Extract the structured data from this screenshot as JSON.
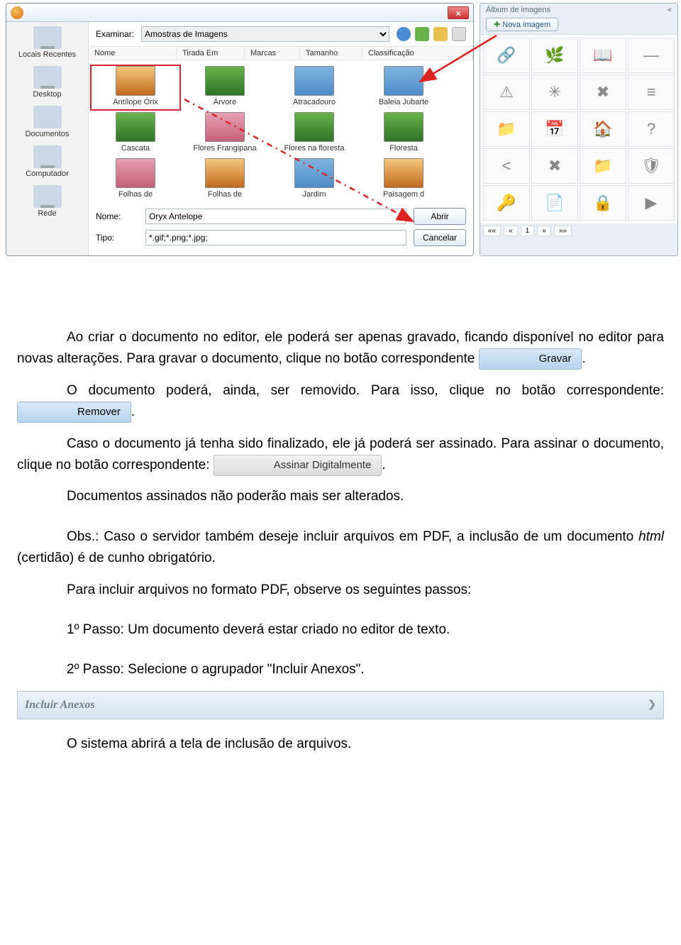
{
  "dialog": {
    "examine_label": "Examinar:",
    "folder": "Amostras de Imagens",
    "columns": [
      "Nome",
      "Tirada Em",
      "Marcas",
      "Tamanho",
      "Classificação"
    ],
    "sidebar": [
      {
        "label": "Locais Recentes"
      },
      {
        "label": "Desktop"
      },
      {
        "label": "Documentos"
      },
      {
        "label": "Computador"
      },
      {
        "label": "Rede"
      }
    ],
    "files": [
      {
        "name": "Antílope Órix",
        "cls": "orange",
        "selected": true
      },
      {
        "name": "Árvore",
        "cls": "green"
      },
      {
        "name": "Atracadouro",
        "cls": ""
      },
      {
        "name": "Baleia Jubarte",
        "cls": ""
      },
      {
        "name": "Cascata",
        "cls": "green"
      },
      {
        "name": "Flores Frangipana",
        "cls": "pink"
      },
      {
        "name": "Flores na floresta",
        "cls": "green"
      },
      {
        "name": "Floresta",
        "cls": "green"
      },
      {
        "name": "Folhas de",
        "cls": "pink"
      },
      {
        "name": "Folhas de",
        "cls": "orange"
      },
      {
        "name": "Jardim",
        "cls": ""
      },
      {
        "name": "Paisagem d",
        "cls": "orange"
      }
    ],
    "name_label": "Nome:",
    "name_value": "Oryx Antelope",
    "type_label": "Tipo:",
    "type_value": "*.gif;*.png;*.jpg;",
    "open_btn": "Abrir",
    "cancel_btn": "Cancelar"
  },
  "album": {
    "title": "Álbum de imagens",
    "new_btn": "Nova imagem",
    "icons": [
      "🔗",
      "🌿",
      "📖",
      "—",
      "⚠",
      "✳",
      "✖",
      "≡",
      "📁",
      "📅",
      "🏠",
      "?",
      "<",
      "✖",
      "📁",
      "🛡",
      "🔑",
      "📄",
      "🔒",
      "▶"
    ],
    "page": "1"
  },
  "doc": {
    "p1a": "Ao criar o documento no editor, ele poderá ser apenas gravado, ficando disponível no editor para novas alterações. Para gravar o documento, clique no botão correspondente ",
    "btn_gravar": "Gravar",
    "p1b": ".",
    "p2a": "O documento poderá, ainda, ser removido. Para isso, clique no botão correspondente: ",
    "btn_remover": "Remover",
    "p2b": ".",
    "p3a": "Caso o documento já tenha sido finalizado, ele já poderá ser assinado. Para assinar o documento, clique no botão correspondente: ",
    "btn_assinar": "Assinar Digitalmente",
    "p3b": ".",
    "p4": "Documentos assinados não poderão mais ser alterados.",
    "p5a": "Obs.: Caso o servidor também deseje incluir arquivos em PDF, a inclusão de um documento ",
    "p5_em": "html",
    "p5b": " (certidão) é de cunho obrigatório.",
    "p6": "Para incluir arquivos no formato PDF, observe os seguintes passos:",
    "p7": "1º Passo: Um documento deverá estar criado no editor de texto.",
    "p8": "2º Passo: Selecione o agrupador \"Incluir Anexos\".",
    "anexos_bar": "Incluir Anexos",
    "p9": "O sistema abrirá a tela de inclusão de arquivos."
  }
}
